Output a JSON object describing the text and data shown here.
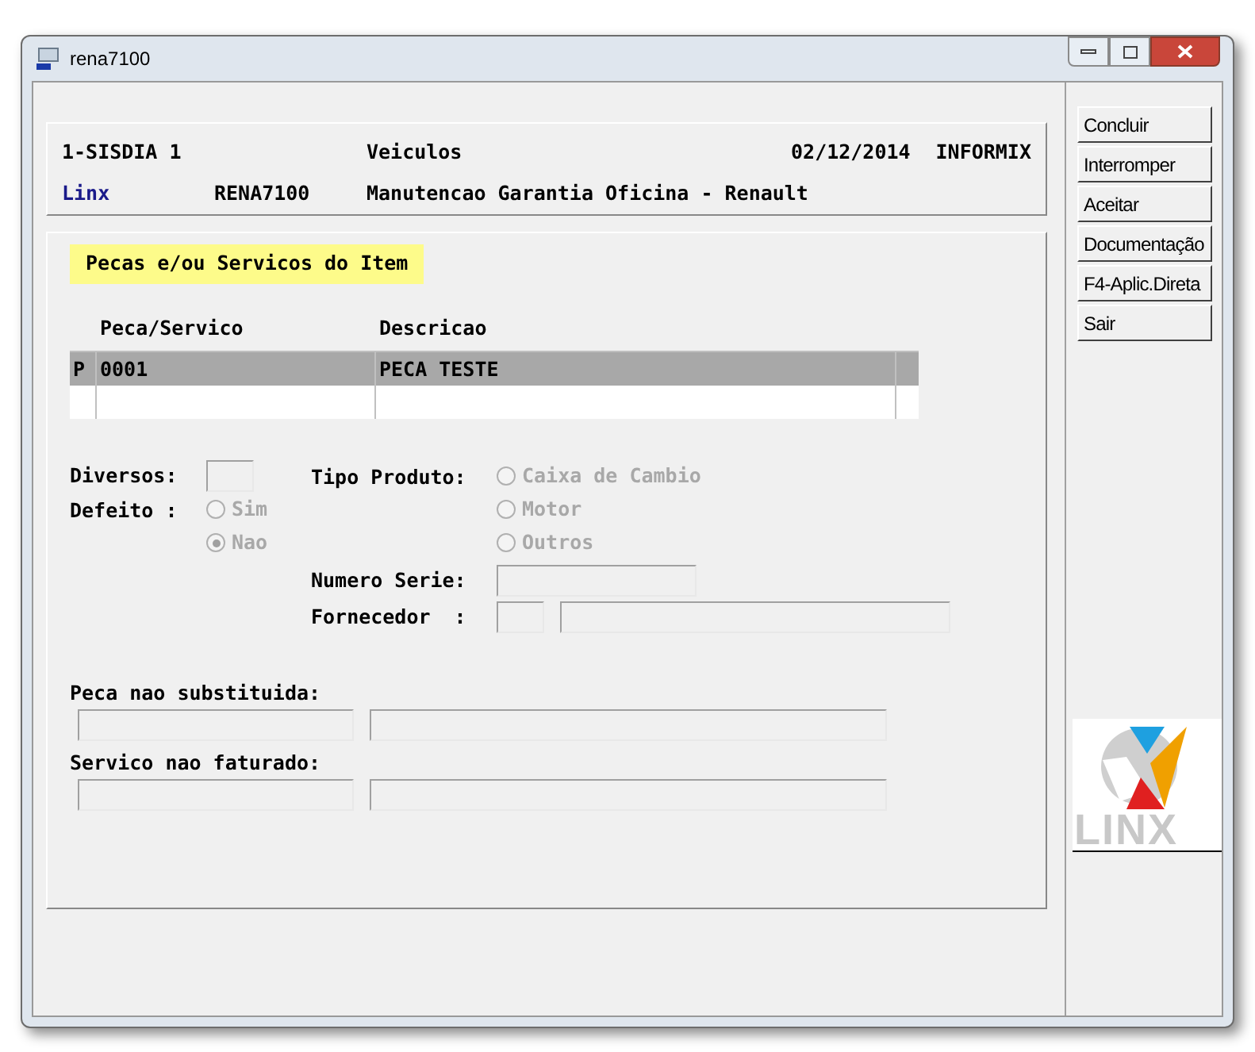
{
  "window": {
    "title": "rena7100"
  },
  "header": {
    "line1": [
      "1-SISDIA 1",
      "Veiculos",
      "02/12/2014",
      "INFORMIX"
    ],
    "line2": [
      "Linx",
      "RENA7100",
      "Manutencao Garantia Oficina - Renault"
    ]
  },
  "section_title": "Pecas e/ou Servicos do Item",
  "table": {
    "columns": [
      "Peca/Servico",
      "Descricao"
    ],
    "rows": [
      {
        "marker": "P",
        "cells": [
          "0001",
          "PECA TESTE"
        ],
        "selected": true
      },
      {
        "selected": false
      }
    ]
  },
  "form": {
    "diversos": "Diversos:",
    "defeito": {
      "label": "Defeito :",
      "disabled": true,
      "options": [
        {
          "label": "Sim",
          "selected": false
        },
        {
          "label": "Nao",
          "selected": true
        }
      ]
    },
    "tipo_produto": {
      "label": "Tipo Produto:",
      "disabled": true,
      "options": [
        {
          "label": "Caixa de Cambio",
          "selected": false
        },
        {
          "label": "Motor",
          "selected": false
        },
        {
          "label": "Outros",
          "selected": false
        }
      ]
    },
    "numero_serie": "Numero Serie:",
    "fornecedor": "Fornecedor  :",
    "peca_nao_substituida": "Peca nao substituida:",
    "servico_nao_faturado": "Servico nao faturado:"
  },
  "buttons": [
    "Concluir",
    "Interromper",
    "Aceitar",
    "Documentação",
    "F4-Aplic.Direta",
    "Sair"
  ],
  "logo": {
    "text": "LINX"
  }
}
